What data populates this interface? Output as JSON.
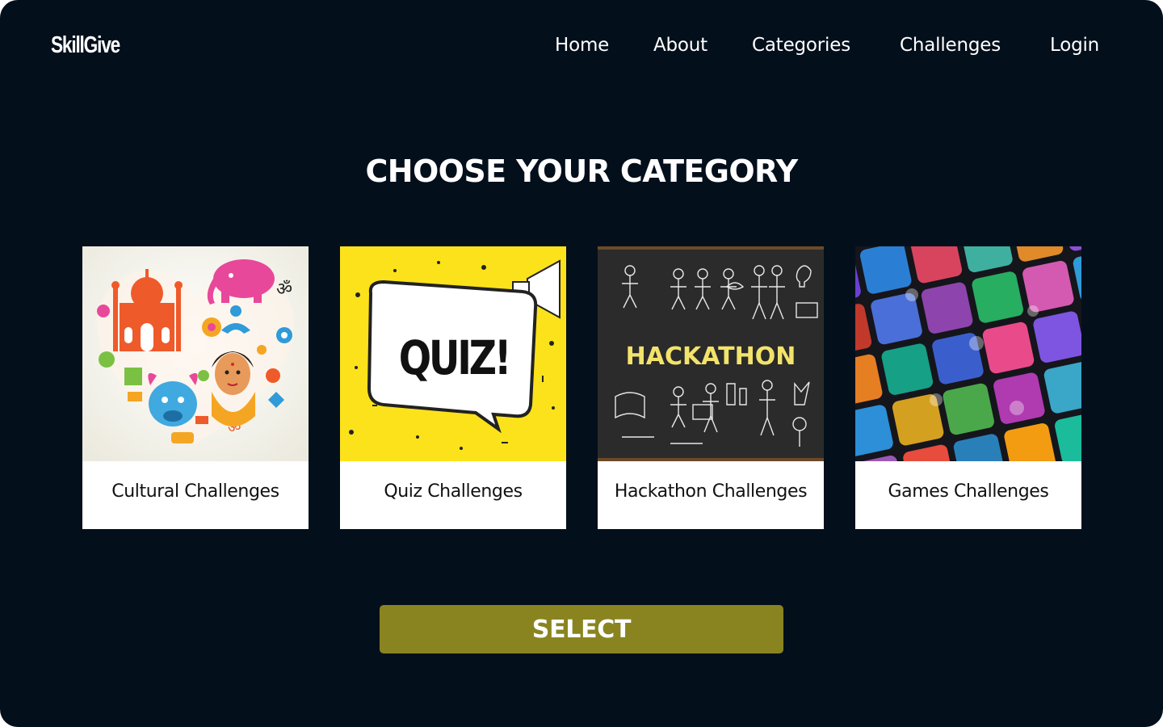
{
  "brand": {
    "logo_text": "SkillGive"
  },
  "nav": {
    "items": [
      {
        "label": "Home"
      },
      {
        "label": "About"
      },
      {
        "label": "Categories"
      },
      {
        "label": "Challenges"
      },
      {
        "label": "Login"
      }
    ]
  },
  "main": {
    "heading": "CHOOSE YOUR CATEGORY",
    "categories": [
      {
        "label": "Cultural Challenges",
        "image_icon": "cultural-heart-collage"
      },
      {
        "label": "Quiz Challenges",
        "image_icon": "quiz-speech-bubble",
        "image_text": "QUIZ!"
      },
      {
        "label": "Hackathon Challenges",
        "image_icon": "hackathon-chalkboard",
        "image_text": "HACKATHON"
      },
      {
        "label": "Games Challenges",
        "image_icon": "game-thumbnails-grid"
      }
    ],
    "select_label": "SELECT"
  },
  "colors": {
    "background": "#040f1c",
    "button": "#8a8420",
    "card": "#ffffff",
    "quiz_yellow": "#fce21b",
    "hackathon_yellow": "#f3e36b"
  }
}
